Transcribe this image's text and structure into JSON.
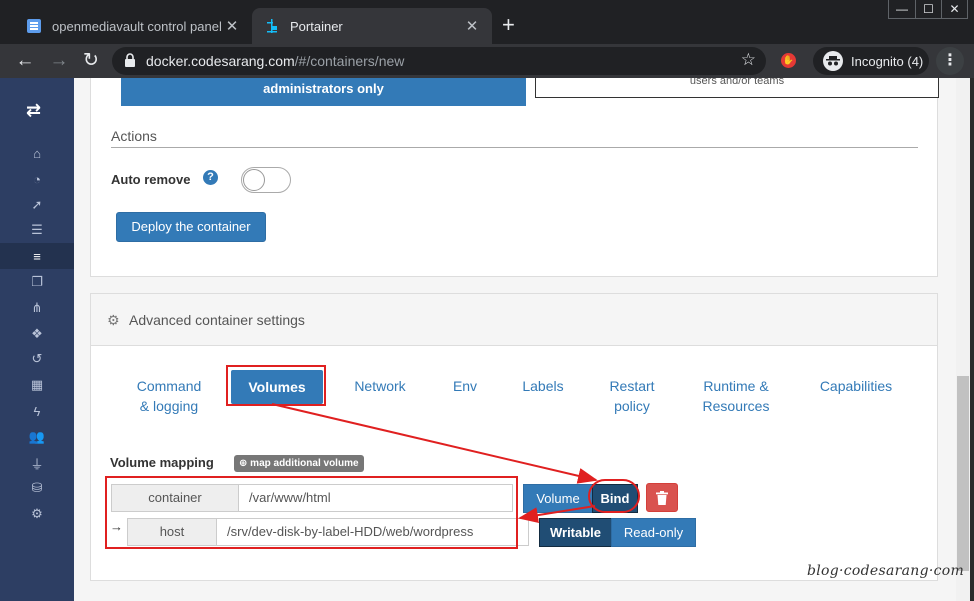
{
  "browser": {
    "tabs": [
      {
        "title": "openmediavault control panel - c",
        "favicon": "omv-icon"
      },
      {
        "title": "Portainer",
        "favicon": "portainer-icon"
      }
    ],
    "url_host": "docker.codesarang.com",
    "url_path": "/#/containers/new",
    "incognito_label": "Incognito (4)",
    "new_tab_symbol": "+",
    "window_controls": [
      "—",
      "☐",
      "✕"
    ]
  },
  "sidebar": {
    "icons": [
      "home-icon",
      "dashboard-icon",
      "rocket-icon",
      "list-icon",
      "server-icon",
      "clone-icon",
      "sitemap-icon",
      "cubes-icon",
      "history-icon",
      "grid-icon",
      "bolt-icon",
      "users-icon",
      "plug-icon",
      "database-icon",
      "cogs-icon"
    ],
    "active_index": 4
  },
  "access": {
    "admin_only_label": "administrators only",
    "users_box_label": "users and/or teams"
  },
  "actions": {
    "section_title": "Actions",
    "auto_remove_label": "Auto remove",
    "help_symbol": "?",
    "deploy_label": "Deploy the container"
  },
  "advanced": {
    "title": "Advanced container settings",
    "tabs": [
      {
        "line1": "Command",
        "line2": "& logging"
      },
      {
        "line1": "Volumes",
        "line2": ""
      },
      {
        "line1": "Network",
        "line2": ""
      },
      {
        "line1": "Env",
        "line2": ""
      },
      {
        "line1": "Labels",
        "line2": ""
      },
      {
        "line1": "Restart",
        "line2": "policy"
      },
      {
        "line1": "Runtime &",
        "line2": "Resources"
      },
      {
        "line1": "Capabilities",
        "line2": ""
      }
    ],
    "active_tab": 1
  },
  "volume_mapping": {
    "label": "Volume mapping",
    "add_label": "map additional volume",
    "container_label": "container",
    "container_value": "/var/www/html",
    "host_label": "host",
    "host_value": "/srv/dev-disk-by-label-HDD/web/wordpress",
    "type_options": [
      "Volume",
      "Bind"
    ],
    "type_selected": "Bind",
    "mode_options": [
      "Writable",
      "Read-only"
    ],
    "mode_selected": "Writable",
    "arrow_symbol": "→"
  },
  "watermark": "blog·codesarang·com",
  "colors": {
    "primary": "#337ab7",
    "primary_dark": "#204d74",
    "danger": "#d9534f",
    "sidebar_bg": "#2d3e63",
    "annotation_red": "#e02020"
  }
}
